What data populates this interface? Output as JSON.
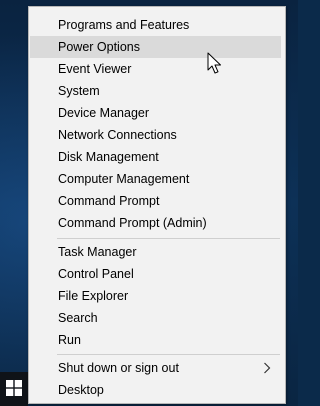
{
  "menu": {
    "group1": [
      {
        "label": "Programs and Features"
      },
      {
        "label": "Power Options",
        "hovered": true
      },
      {
        "label": "Event Viewer"
      },
      {
        "label": "System"
      },
      {
        "label": "Device Manager"
      },
      {
        "label": "Network Connections"
      },
      {
        "label": "Disk Management"
      },
      {
        "label": "Computer Management"
      },
      {
        "label": "Command Prompt"
      },
      {
        "label": "Command Prompt (Admin)"
      }
    ],
    "group2": [
      {
        "label": "Task Manager"
      },
      {
        "label": "Control Panel"
      },
      {
        "label": "File Explorer"
      },
      {
        "label": "Search"
      },
      {
        "label": "Run"
      }
    ],
    "group3": [
      {
        "label": "Shut down or sign out",
        "submenu": true
      },
      {
        "label": "Desktop"
      }
    ]
  },
  "colors": {
    "menu_background": "#f2f2f2",
    "hover_highlight": "#dadada",
    "desktop_background": "#0d3157",
    "taskbar": "#0f1318"
  },
  "icons": {
    "start": "windows-logo-icon",
    "submenu": "chevron-right-icon",
    "pointer": "mouse-cursor-icon"
  }
}
